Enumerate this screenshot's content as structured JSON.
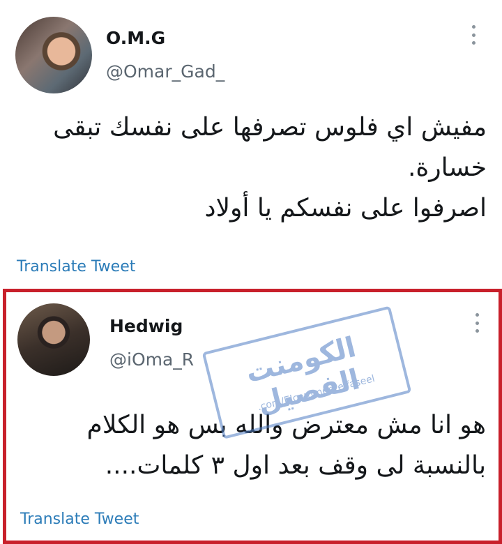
{
  "tweets": [
    {
      "display_name": "O.M.G",
      "handle": "@Omar_Gad_",
      "text_lines": [
        "مفيش اي فلوس تصرفها على نفسك تبقى",
        "خسارة.",
        "اصرفوا على نفسكم يا أولاد"
      ],
      "translate_label": "Translate Tweet"
    },
    {
      "display_name": "Hedwig",
      "handle": "@iOma_R",
      "text_lines": [
        "هو انا مش معترض والله بس هو الكلام",
        "بالنسبة لى وقف بعد اول ٣ كلمات...."
      ],
      "translate_label": "Translate Tweet"
    }
  ],
  "watermark": {
    "title": "الكومنت الفصيل",
    "url": ".com/Elcommentelfaseel"
  },
  "colors": {
    "highlight_border": "#c8202b",
    "link": "#2c7cb8",
    "watermark": "#4f7ec4"
  },
  "icons": [
    "more-options-icon"
  ]
}
